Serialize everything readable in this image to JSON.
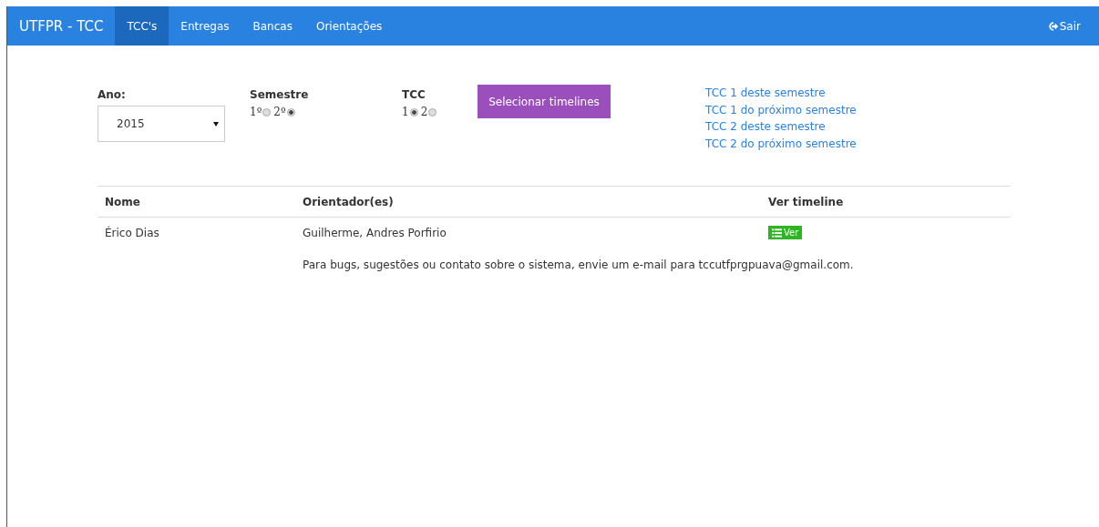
{
  "navbar": {
    "brand": "UTFPR - TCC",
    "items": [
      {
        "label": "TCC's",
        "selected": true
      },
      {
        "label": "Entregas",
        "selected": false
      },
      {
        "label": "Bancas",
        "selected": false
      },
      {
        "label": "Orientações",
        "selected": false
      }
    ],
    "logout": "Sair"
  },
  "filters": {
    "year": {
      "label": "Ano:",
      "value": "2015"
    },
    "semester": {
      "label": "Semestre",
      "options": [
        {
          "label": "1º",
          "selected": false
        },
        {
          "label": "2º",
          "selected": true
        }
      ]
    },
    "tcc": {
      "label": "TCC",
      "options": [
        {
          "label": "1",
          "selected": true
        },
        {
          "label": "2",
          "selected": false
        }
      ]
    },
    "button": "Selecionar timelines",
    "links": [
      "TCC 1 deste semestre",
      "TCC 1 do próximo semestre",
      "TCC 2 deste semestre",
      "TCC 2 do próximo semestre"
    ]
  },
  "table": {
    "columns": [
      "Nome",
      "Orientador(es)",
      "Ver timeline"
    ],
    "rows": [
      {
        "name": "Érico Dias",
        "advisors": "Guilherme, Andres Porfirio",
        "action": "Ver"
      }
    ]
  },
  "footer": "Para bugs, sugestões ou contato sobre o sistema, envie um e-mail para tccutfprgpuava@gmail.com."
}
